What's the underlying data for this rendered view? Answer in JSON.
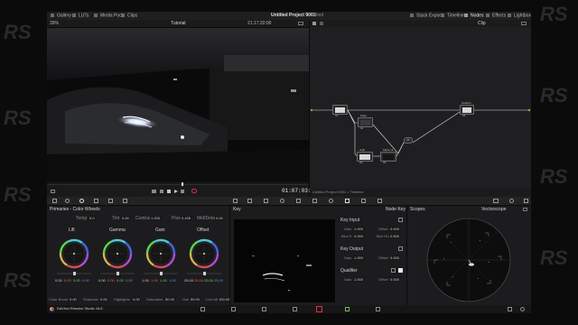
{
  "colors": {
    "app_bg": "#0b0b0c",
    "panel_bg": "#1c1c1e",
    "accent_red": "#e0323c",
    "node_line": "#d9d9d9",
    "node_green": "#7ab648"
  },
  "topbar": {
    "items": [
      {
        "label": "Gallery",
        "icon": "gallery-icon"
      },
      {
        "label": "LUTs",
        "icon": "luts-icon"
      },
      {
        "label": "Media Pool",
        "icon": "media-pool-icon"
      },
      {
        "label": "Clips",
        "icon": "clips-icon"
      }
    ],
    "project_title": "Untitled Project 9001",
    "edited": "Edited",
    "right_items": [
      {
        "label": "Stack Export",
        "icon": "stack-icon"
      },
      {
        "label": "Timeline",
        "icon": "timeline-icon"
      },
      {
        "label": "Nodes",
        "icon": "nodes-icon"
      },
      {
        "label": "Effects",
        "icon": "effects-icon"
      },
      {
        "label": "Lightbox",
        "icon": "lightbox-icon"
      }
    ]
  },
  "viewer": {
    "zoom": "39%",
    "timeline_name": "Tutorial",
    "timecode_top": "21:17:20:00",
    "timecode": "01:07:03:10"
  },
  "node_editor": {
    "clip_label": "Clip",
    "footer": "Untitled Project 9001 > Timeline",
    "nodes": [
      {
        "id": "01",
        "label": ""
      },
      {
        "id": "02",
        "label": "Edge"
      },
      {
        "id": "03",
        "label": "High"
      },
      {
        "id": "04",
        "label": "Matte Hi..."
      },
      {
        "id": "05",
        "label": ""
      },
      {
        "id": "06",
        "label": "Halation"
      }
    ]
  },
  "primaries": {
    "title": "Primaries - Color Wheels",
    "top_params": [
      {
        "label": "Temp",
        "value": "0.0"
      },
      {
        "label": "Tint",
        "value": "0.00"
      },
      {
        "label": "Contrast",
        "value": "1.000"
      },
      {
        "label": "Pivot",
        "value": "0.435"
      },
      {
        "label": "Mid/Detail",
        "value": "0.00"
      }
    ],
    "wheels": [
      {
        "name": "Lift",
        "values": [
          "0.00",
          "0.00",
          "0.00",
          "0.00"
        ]
      },
      {
        "name": "Gamma",
        "values": [
          "0.00",
          "0.00",
          "0.00",
          "0.00"
        ]
      },
      {
        "name": "Gain",
        "values": [
          "1.00",
          "1.00",
          "1.00",
          "1.00"
        ]
      },
      {
        "name": "Offset",
        "values": [
          "25.00",
          "25.00",
          "25.00",
          "25.00"
        ]
      }
    ],
    "bottom_params": [
      {
        "label": "Color Boost",
        "value": "0.00"
      },
      {
        "label": "Shadows",
        "value": "0.00"
      },
      {
        "label": "Highlights",
        "value": "0.00"
      },
      {
        "label": "Saturation",
        "value": "50.00"
      },
      {
        "label": "Hue",
        "value": "50.00"
      },
      {
        "label": "Lum Mix",
        "value": "100.00"
      }
    ]
  },
  "key_panel": {
    "title": "Key",
    "node_key_title": "Node Key",
    "sections": [
      {
        "title": "Key Input",
        "gain": "1.000",
        "offset": "0.000",
        "blur_r": "0.000",
        "blur_hv": "0.500"
      },
      {
        "title": "Key Output",
        "gain": "1.000",
        "offset": "0.000"
      },
      {
        "title": "Qualifier",
        "gain": "1.000",
        "offset": "0.000"
      }
    ],
    "labels": {
      "gain": "Gain",
      "offset": "Offset",
      "blur_r": "Blur R.",
      "blur_hv": "Blur H/V"
    }
  },
  "scopes": {
    "title": "Scopes",
    "mode": "Vectorscope"
  },
  "bottom_bar": {
    "app_name": "DaVinci Resolve Studio 18.6"
  },
  "watermark": "RS"
}
